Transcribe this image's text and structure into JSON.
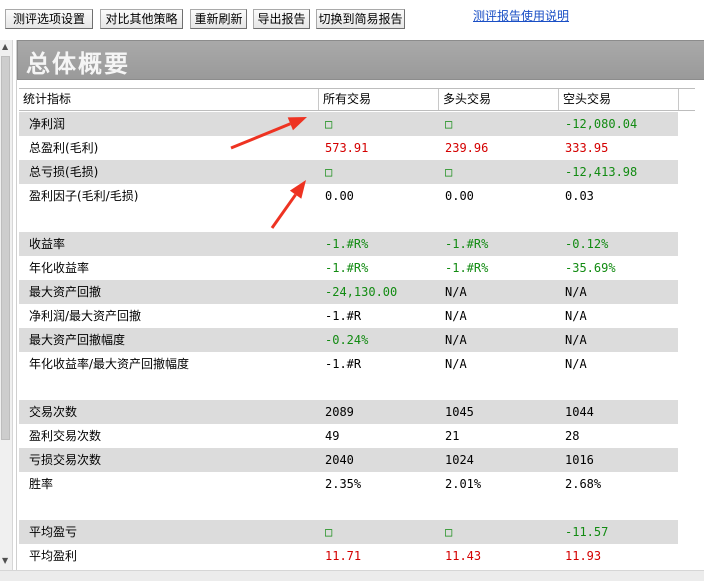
{
  "toolbar": {
    "buttons": [
      "测评选项设置",
      "对比其他策略",
      "重新刷新",
      "导出报告",
      "切换到简易报告"
    ],
    "help_link": "测评报告使用说明"
  },
  "section_title": "总体概要",
  "table": {
    "headers": [
      "统计指标",
      "所有交易",
      "多头交易",
      "空头交易"
    ],
    "rows": [
      {
        "label": "净利润",
        "all": "□",
        "long": "□",
        "short": "-12,080.04",
        "colors": [
          "green",
          "green",
          "green"
        ]
      },
      {
        "label": "总盈利(毛利)",
        "all": "573.91",
        "long": "239.96",
        "short": "333.95",
        "colors": [
          "red",
          "red",
          "red"
        ]
      },
      {
        "label": "总亏损(毛损)",
        "all": "□",
        "long": "□",
        "short": "-12,413.98",
        "colors": [
          "green",
          "green",
          "green"
        ]
      },
      {
        "label": "盈利因子(毛利/毛损)",
        "all": "0.00",
        "long": "0.00",
        "short": "0.03",
        "colors": [
          "black",
          "black",
          "black"
        ]
      },
      {
        "label": "收益率",
        "all": "-1.#R%",
        "long": "-1.#R%",
        "short": "-0.12%",
        "colors": [
          "green",
          "green",
          "green"
        ]
      },
      {
        "label": "年化收益率",
        "all": "-1.#R%",
        "long": "-1.#R%",
        "short": "-35.69%",
        "colors": [
          "green",
          "green",
          "green"
        ]
      },
      {
        "label": "最大资产回撤",
        "all": "-24,130.00",
        "long": "N/A",
        "short": "N/A",
        "colors": [
          "green",
          "black",
          "black"
        ]
      },
      {
        "label": "净利润/最大资产回撤",
        "all": "-1.#R",
        "long": "N/A",
        "short": "N/A",
        "colors": [
          "black",
          "black",
          "black"
        ]
      },
      {
        "label": "最大资产回撤幅度",
        "all": "-0.24%",
        "long": "N/A",
        "short": "N/A",
        "colors": [
          "green",
          "black",
          "black"
        ]
      },
      {
        "label": "年化收益率/最大资产回撤幅度",
        "all": "-1.#R",
        "long": "N/A",
        "short": "N/A",
        "colors": [
          "black",
          "black",
          "black"
        ]
      },
      {
        "label": "交易次数",
        "all": "2089",
        "long": "1045",
        "short": "1044",
        "colors": [
          "black",
          "black",
          "black"
        ]
      },
      {
        "label": "盈利交易次数",
        "all": "49",
        "long": "21",
        "short": "28",
        "colors": [
          "black",
          "black",
          "black"
        ]
      },
      {
        "label": "亏损交易次数",
        "all": "2040",
        "long": "1024",
        "short": "1016",
        "colors": [
          "black",
          "black",
          "black"
        ]
      },
      {
        "label": "胜率",
        "all": "2.35%",
        "long": "2.01%",
        "short": "2.68%",
        "colors": [
          "black",
          "black",
          "black"
        ]
      },
      {
        "label": "平均盈亏",
        "all": "□",
        "long": "□",
        "short": "-11.57",
        "colors": [
          "green",
          "green",
          "green"
        ]
      },
      {
        "label": "平均盈利",
        "all": "11.71",
        "long": "11.43",
        "short": "11.93",
        "colors": [
          "red",
          "red",
          "red"
        ]
      }
    ]
  },
  "annotations": {
    "arrow_color": "#ee3322"
  }
}
